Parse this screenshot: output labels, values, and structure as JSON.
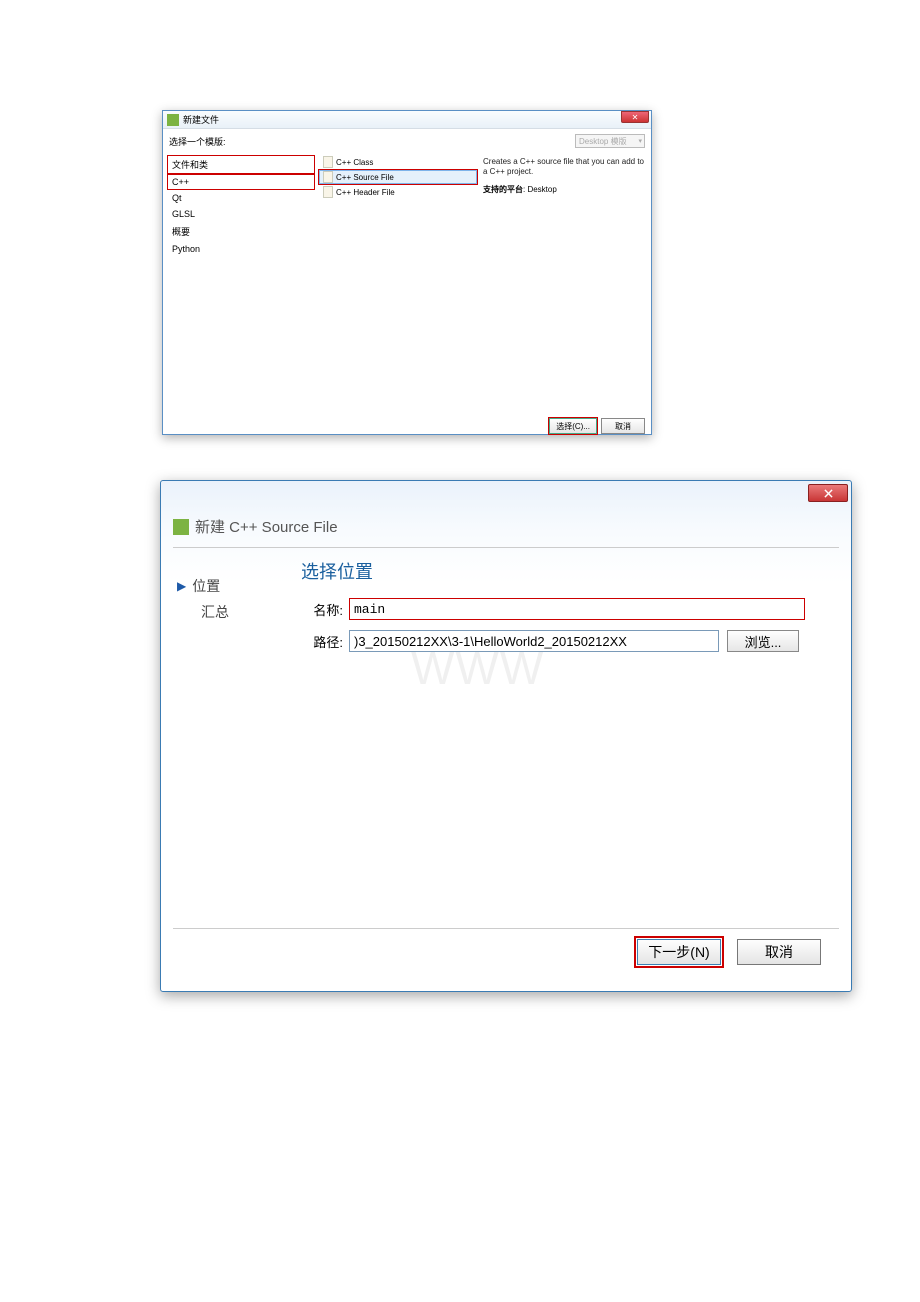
{
  "dialog1": {
    "title": "新建文件",
    "subtitle": "选择一个模版:",
    "filter": "Desktop 模版",
    "categories": [
      "文件和类",
      "C++",
      "Qt",
      "GLSL",
      "概要",
      "Python"
    ],
    "options": [
      "C++ Class",
      "C++ Source File",
      "C++ Header File"
    ],
    "description": "Creates a C++ source file that you can add to a C++ project.",
    "platformLabel": "支持的平台",
    "platformValue": ": Desktop",
    "chooseBtn": "选择(C)...",
    "cancelBtn": "取消"
  },
  "dialog2": {
    "title": "新建 C++ Source File",
    "steps": {
      "loc": "位置",
      "sum": "汇总"
    },
    "formTitle": "选择位置",
    "nameLabel": "名称:",
    "nameValue": "main",
    "pathLabel": "路径:",
    "pathValue": ")3_20150212XX\\3-1\\HelloWorld2_20150212XX",
    "browseBtn": "浏览...",
    "nextBtn": "下一步(N)",
    "cancelBtn": "取消"
  }
}
